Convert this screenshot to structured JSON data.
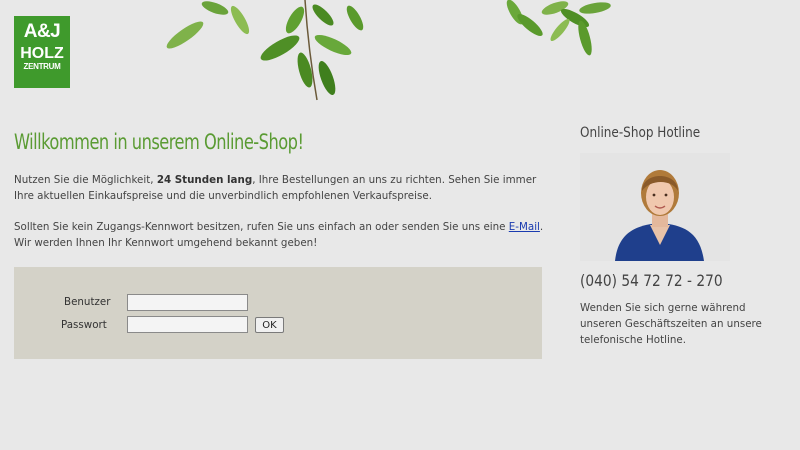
{
  "logo": {
    "line1": "A&J",
    "line2": "HOLZ",
    "line3": "ZENTRUM"
  },
  "colors": {
    "brand_green": "#3f9a2c",
    "heading_green": "#5a9b33",
    "login_bg": "#d4d2c8",
    "link": "#1a3bb0"
  },
  "main": {
    "welcome": "Willkommen in unserem Online-Shop!",
    "intro_before": "Nutzen Sie die Möglichkeit, ",
    "intro_bold": "24 Stunden lang",
    "intro_after": ", Ihre Bestellungen an uns zu richten. Sehen Sie immer Ihre aktuellen Einkaufspreise und die unverbindlich empfohlenen Verkaufspreise.",
    "intro2_before": "Sollten Sie kein Zugangs-Kennwort besitzen, rufen Sie uns einfach an oder senden Sie uns eine ",
    "intro2_link": "E-Mail",
    "intro2_after": ". Wir werden Ihnen Ihr Kennwort umgehend bekannt geben!"
  },
  "login": {
    "user_label": "Benutzer",
    "pass_label": "Passwort",
    "user_value": "",
    "pass_value": "",
    "ok_label": "OK"
  },
  "sidebar": {
    "title": "Online-Shop Hotline",
    "phone": "(040) 54 72 72 - 270",
    "hint": "Wenden Sie sich gerne während unseren Geschäftszeiten an unsere telefonische Hotline."
  }
}
